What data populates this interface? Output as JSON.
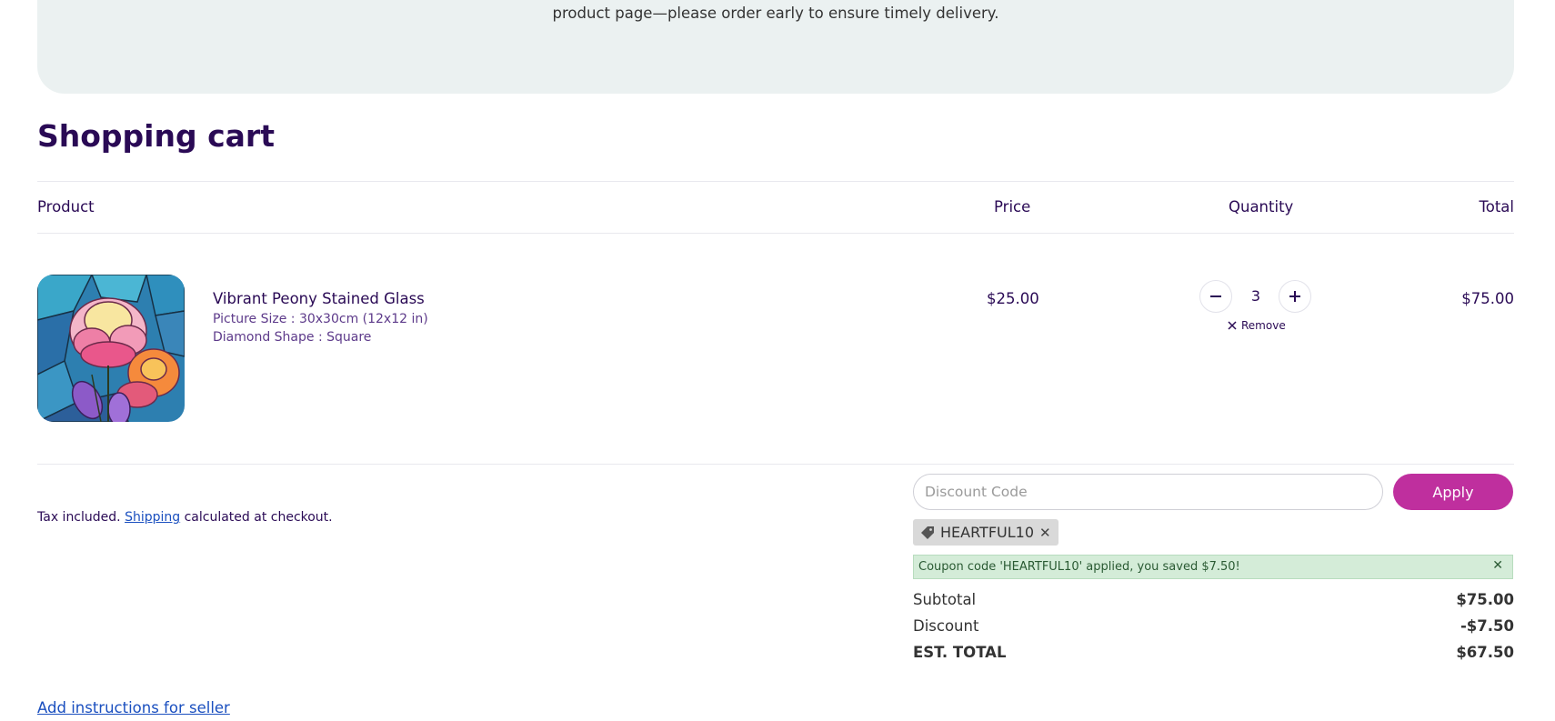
{
  "banner": {
    "text": "product page—please order early to ensure timely delivery."
  },
  "cart": {
    "title": "Shopping cart",
    "headers": {
      "product": "Product",
      "price": "Price",
      "quantity": "Quantity",
      "total": "Total"
    },
    "items": [
      {
        "name": "Vibrant Peony Stained Glass",
        "options": [
          "Picture Size : 30x30cm (12x12 in)",
          "Diamond Shape : Square"
        ],
        "price": "$25.00",
        "quantity": "3",
        "line_total": "$75.00",
        "remove_label": "Remove",
        "image_icon": "peony-stained-glass-thumbnail"
      }
    ]
  },
  "footer": {
    "tax_prefix": "Tax included.",
    "shipping_link": "Shipping",
    "tax_suffix": "calculated at checkout.",
    "seller_link": "Add instructions for seller"
  },
  "discount": {
    "placeholder": "Discount Code",
    "value": "",
    "apply_label": "Apply",
    "applied_code": "HEARTFUL10",
    "message": "Coupon code 'HEARTFUL10' applied, you saved $7.50!",
    "apply_color": "#bf2f9e",
    "alert_color": "#d4ecd8"
  },
  "summary": {
    "subtotal_label": "Subtotal",
    "subtotal": "$75.00",
    "discount_label": "Discount",
    "discount": "-$7.50",
    "total_label": "EST. TOTAL",
    "total": "$67.50"
  },
  "colors": {
    "brand": "#2a0a55",
    "link": "#1a4fbf",
    "banner_bg": "#ebf1f1"
  }
}
